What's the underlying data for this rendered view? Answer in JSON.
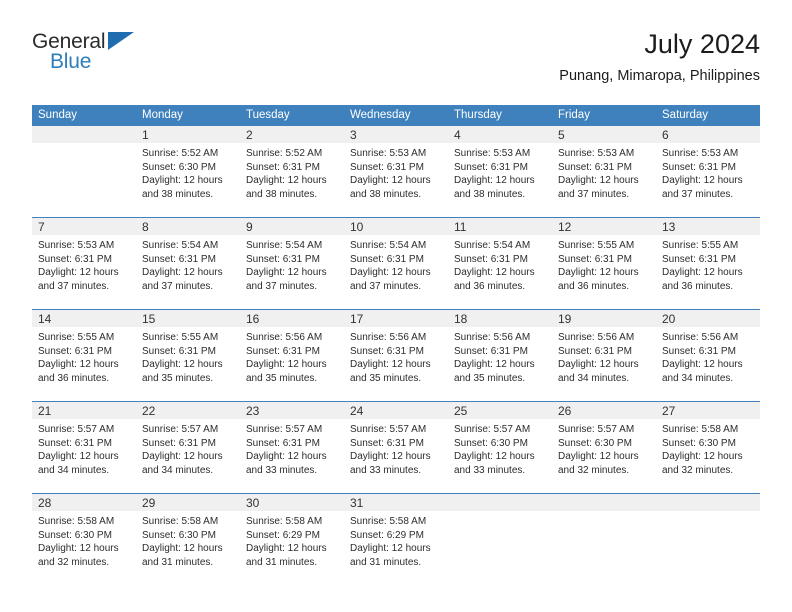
{
  "logo": {
    "word_top": "General",
    "word_bottom": "Blue",
    "triangle_color": "#1f6cb0",
    "blue_color": "#2e7ebb"
  },
  "header": {
    "title": "July 2024",
    "subtitle": "Punang, Mimaropa, Philippines",
    "header_bg": "#3f81bd",
    "header_text_color": "#ffffff"
  },
  "weekdays": [
    "Sunday",
    "Monday",
    "Tuesday",
    "Wednesday",
    "Thursday",
    "Friday",
    "Saturday"
  ],
  "weeks": [
    [
      {
        "day": "",
        "sunrise": "",
        "sunset": "",
        "daylight1": "",
        "daylight2": ""
      },
      {
        "day": "1",
        "sunrise": "Sunrise: 5:52 AM",
        "sunset": "Sunset: 6:30 PM",
        "daylight1": "Daylight: 12 hours",
        "daylight2": "and 38 minutes."
      },
      {
        "day": "2",
        "sunrise": "Sunrise: 5:52 AM",
        "sunset": "Sunset: 6:31 PM",
        "daylight1": "Daylight: 12 hours",
        "daylight2": "and 38 minutes."
      },
      {
        "day": "3",
        "sunrise": "Sunrise: 5:53 AM",
        "sunset": "Sunset: 6:31 PM",
        "daylight1": "Daylight: 12 hours",
        "daylight2": "and 38 minutes."
      },
      {
        "day": "4",
        "sunrise": "Sunrise: 5:53 AM",
        "sunset": "Sunset: 6:31 PM",
        "daylight1": "Daylight: 12 hours",
        "daylight2": "and 38 minutes."
      },
      {
        "day": "5",
        "sunrise": "Sunrise: 5:53 AM",
        "sunset": "Sunset: 6:31 PM",
        "daylight1": "Daylight: 12 hours",
        "daylight2": "and 37 minutes."
      },
      {
        "day": "6",
        "sunrise": "Sunrise: 5:53 AM",
        "sunset": "Sunset: 6:31 PM",
        "daylight1": "Daylight: 12 hours",
        "daylight2": "and 37 minutes."
      }
    ],
    [
      {
        "day": "7",
        "sunrise": "Sunrise: 5:53 AM",
        "sunset": "Sunset: 6:31 PM",
        "daylight1": "Daylight: 12 hours",
        "daylight2": "and 37 minutes."
      },
      {
        "day": "8",
        "sunrise": "Sunrise: 5:54 AM",
        "sunset": "Sunset: 6:31 PM",
        "daylight1": "Daylight: 12 hours",
        "daylight2": "and 37 minutes."
      },
      {
        "day": "9",
        "sunrise": "Sunrise: 5:54 AM",
        "sunset": "Sunset: 6:31 PM",
        "daylight1": "Daylight: 12 hours",
        "daylight2": "and 37 minutes."
      },
      {
        "day": "10",
        "sunrise": "Sunrise: 5:54 AM",
        "sunset": "Sunset: 6:31 PM",
        "daylight1": "Daylight: 12 hours",
        "daylight2": "and 37 minutes."
      },
      {
        "day": "11",
        "sunrise": "Sunrise: 5:54 AM",
        "sunset": "Sunset: 6:31 PM",
        "daylight1": "Daylight: 12 hours",
        "daylight2": "and 36 minutes."
      },
      {
        "day": "12",
        "sunrise": "Sunrise: 5:55 AM",
        "sunset": "Sunset: 6:31 PM",
        "daylight1": "Daylight: 12 hours",
        "daylight2": "and 36 minutes."
      },
      {
        "day": "13",
        "sunrise": "Sunrise: 5:55 AM",
        "sunset": "Sunset: 6:31 PM",
        "daylight1": "Daylight: 12 hours",
        "daylight2": "and 36 minutes."
      }
    ],
    [
      {
        "day": "14",
        "sunrise": "Sunrise: 5:55 AM",
        "sunset": "Sunset: 6:31 PM",
        "daylight1": "Daylight: 12 hours",
        "daylight2": "and 36 minutes."
      },
      {
        "day": "15",
        "sunrise": "Sunrise: 5:55 AM",
        "sunset": "Sunset: 6:31 PM",
        "daylight1": "Daylight: 12 hours",
        "daylight2": "and 35 minutes."
      },
      {
        "day": "16",
        "sunrise": "Sunrise: 5:56 AM",
        "sunset": "Sunset: 6:31 PM",
        "daylight1": "Daylight: 12 hours",
        "daylight2": "and 35 minutes."
      },
      {
        "day": "17",
        "sunrise": "Sunrise: 5:56 AM",
        "sunset": "Sunset: 6:31 PM",
        "daylight1": "Daylight: 12 hours",
        "daylight2": "and 35 minutes."
      },
      {
        "day": "18",
        "sunrise": "Sunrise: 5:56 AM",
        "sunset": "Sunset: 6:31 PM",
        "daylight1": "Daylight: 12 hours",
        "daylight2": "and 35 minutes."
      },
      {
        "day": "19",
        "sunrise": "Sunrise: 5:56 AM",
        "sunset": "Sunset: 6:31 PM",
        "daylight1": "Daylight: 12 hours",
        "daylight2": "and 34 minutes."
      },
      {
        "day": "20",
        "sunrise": "Sunrise: 5:56 AM",
        "sunset": "Sunset: 6:31 PM",
        "daylight1": "Daylight: 12 hours",
        "daylight2": "and 34 minutes."
      }
    ],
    [
      {
        "day": "21",
        "sunrise": "Sunrise: 5:57 AM",
        "sunset": "Sunset: 6:31 PM",
        "daylight1": "Daylight: 12 hours",
        "daylight2": "and 34 minutes."
      },
      {
        "day": "22",
        "sunrise": "Sunrise: 5:57 AM",
        "sunset": "Sunset: 6:31 PM",
        "daylight1": "Daylight: 12 hours",
        "daylight2": "and 34 minutes."
      },
      {
        "day": "23",
        "sunrise": "Sunrise: 5:57 AM",
        "sunset": "Sunset: 6:31 PM",
        "daylight1": "Daylight: 12 hours",
        "daylight2": "and 33 minutes."
      },
      {
        "day": "24",
        "sunrise": "Sunrise: 5:57 AM",
        "sunset": "Sunset: 6:31 PM",
        "daylight1": "Daylight: 12 hours",
        "daylight2": "and 33 minutes."
      },
      {
        "day": "25",
        "sunrise": "Sunrise: 5:57 AM",
        "sunset": "Sunset: 6:30 PM",
        "daylight1": "Daylight: 12 hours",
        "daylight2": "and 33 minutes."
      },
      {
        "day": "26",
        "sunrise": "Sunrise: 5:57 AM",
        "sunset": "Sunset: 6:30 PM",
        "daylight1": "Daylight: 12 hours",
        "daylight2": "and 32 minutes."
      },
      {
        "day": "27",
        "sunrise": "Sunrise: 5:58 AM",
        "sunset": "Sunset: 6:30 PM",
        "daylight1": "Daylight: 12 hours",
        "daylight2": "and 32 minutes."
      }
    ],
    [
      {
        "day": "28",
        "sunrise": "Sunrise: 5:58 AM",
        "sunset": "Sunset: 6:30 PM",
        "daylight1": "Daylight: 12 hours",
        "daylight2": "and 32 minutes."
      },
      {
        "day": "29",
        "sunrise": "Sunrise: 5:58 AM",
        "sunset": "Sunset: 6:30 PM",
        "daylight1": "Daylight: 12 hours",
        "daylight2": "and 31 minutes."
      },
      {
        "day": "30",
        "sunrise": "Sunrise: 5:58 AM",
        "sunset": "Sunset: 6:29 PM",
        "daylight1": "Daylight: 12 hours",
        "daylight2": "and 31 minutes."
      },
      {
        "day": "31",
        "sunrise": "Sunrise: 5:58 AM",
        "sunset": "Sunset: 6:29 PM",
        "daylight1": "Daylight: 12 hours",
        "daylight2": "and 31 minutes."
      },
      {
        "day": "",
        "sunrise": "",
        "sunset": "",
        "daylight1": "",
        "daylight2": ""
      },
      {
        "day": "",
        "sunrise": "",
        "sunset": "",
        "daylight1": "",
        "daylight2": ""
      },
      {
        "day": "",
        "sunrise": "",
        "sunset": "",
        "daylight1": "",
        "daylight2": ""
      }
    ]
  ]
}
